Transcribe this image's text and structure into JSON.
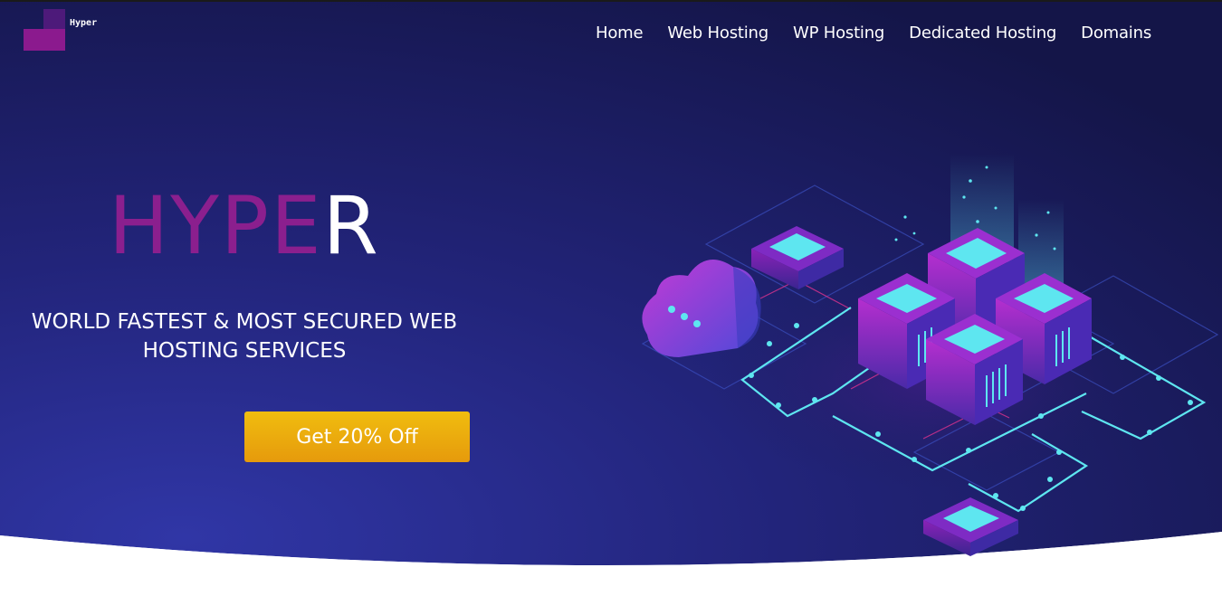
{
  "brand": {
    "name": "Hyper"
  },
  "nav": {
    "items": [
      "Home",
      "Web Hosting",
      "WP Hosting",
      "Dedicated Hosting",
      "Domains"
    ]
  },
  "hero": {
    "title_main": "HYPE",
    "title_last": "R",
    "subtitle_line1": "WORLD FASTEST & MOST SECURED WEB",
    "subtitle_line2": "HOSTING SERVICES",
    "cta_label": "Get 20% Off"
  },
  "colors": {
    "hero_bg_dark": "#15174d",
    "hero_bg_light": "#2e2f9e",
    "brand_purple": "#8b1f8e",
    "cta_yellow": "#f0bd0f",
    "cta_orange": "#e69a0c",
    "glow_cyan": "#5ee6f0"
  },
  "icons": {
    "illustration": "isometric-server-network-illustration",
    "cloud": "cloud-icon"
  }
}
